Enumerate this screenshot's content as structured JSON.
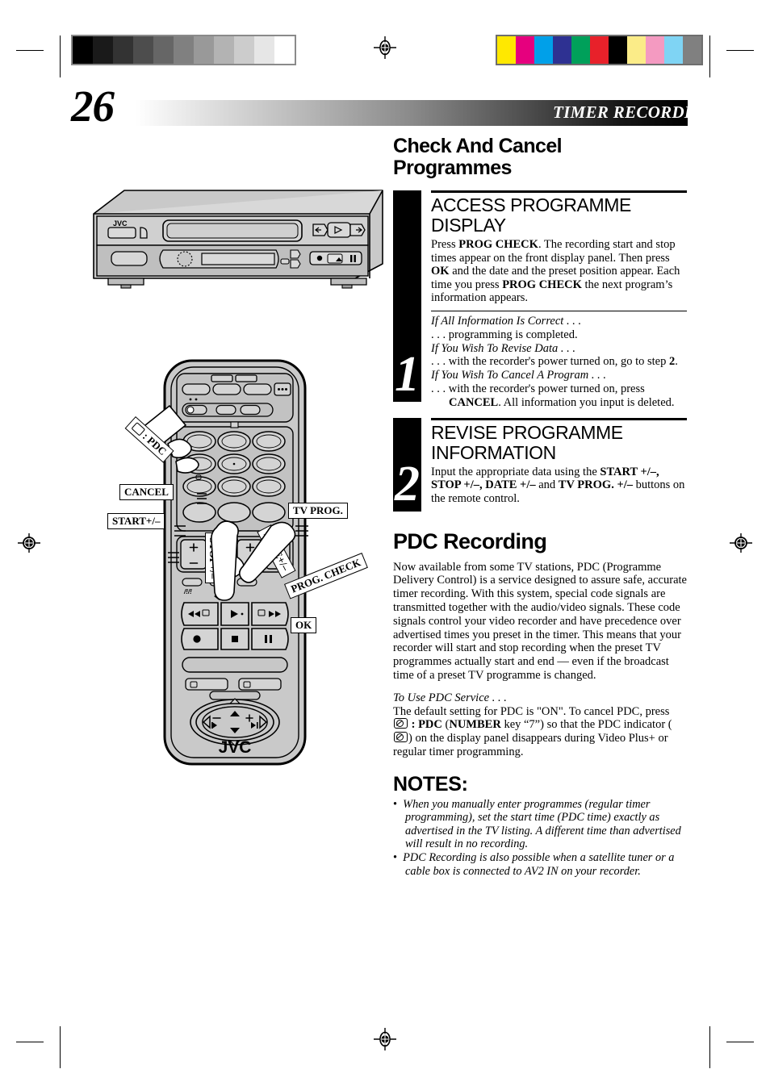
{
  "header": {
    "page_number": "26",
    "title": "TIMER RECORDING(cont.)"
  },
  "section": {
    "title_line1": "Check And Cancel",
    "title_line2": "Programmes"
  },
  "steps": [
    {
      "number": "1",
      "heading_line1": "ACCESS PROGRAMME",
      "heading_line2": "DISPLAY",
      "body_html": "Press <b>PROG CHECK</b>. The recording start and stop times appear on the front display panel. Then press <b>OK</b> and the date and the preset position appear. Each time you press <b>PROG CHECK</b> the next program&rsquo;s information appears.",
      "sub_lines": [
        {
          "style": "italic",
          "text": "If All Information Is Correct . . ."
        },
        {
          "style": "roman",
          "text": ". . . programming is completed."
        },
        {
          "style": "italic",
          "text": "If You Wish To Revise Data . . ."
        },
        {
          "style": "roman",
          "html": ". . . with the recorder's power turned on, go to step <b>2</b>."
        },
        {
          "style": "italic",
          "text": "If You Wish To Cancel A Program . . ."
        },
        {
          "style": "roman",
          "html": ". . . with the recorder's power turned on, press <b>CANCEL</b>. All information you input is deleted."
        }
      ]
    },
    {
      "number": "2",
      "heading_line1": "REVISE PROGRAMME",
      "heading_line2": "INFORMATION",
      "body_html": "Input the appropriate data using the <b>START +/&ndash;, STOP +/&ndash;, DATE +/&ndash;</b> and <b>TV PROG. +/&ndash;</b> buttons on the remote control.",
      "sub_lines": []
    }
  ],
  "pdc": {
    "title": "PDC Recording",
    "paragraph": "Now available from some TV stations, PDC (Programme Delivery Control) is a service designed to assure safe, accurate timer recording. With this system, special code signals are transmitted together with the audio/video signals. These code signals control your video recorder and have precedence over advertised times you preset in the timer. This means that your recorder will start and stop recording when the preset TV programmes actually start and end — even if the broadcast time of a preset TV programme is changed.",
    "service_heading": "To Use PDC Service . . .",
    "service_paragraph_html": "The default setting for PDC is \"ON\". To cancel PDC, press <span class=\"pdcicon\" data-name=\"pdc-symbol-icon\" data-interactable=\"false\"></span> <b>: PDC</b> (<b>NUMBER</b> key &ldquo;7&rdquo;) so that the PDC indicator (<span class=\"pdcicon\" data-name=\"pdc-symbol-icon\" data-interactable=\"false\"></span>) on the display panel disappears during Video Plus+ or regular timer programming."
  },
  "notes": {
    "title": "NOTES:",
    "items": [
      "When you manually enter programmes (regular timer programming), set the start time (PDC time) exactly as advertised in the TV listing. A different time than advertised will result in no recording.",
      "PDC Recording is also possible when a satellite tuner or a cable box is connected to AV2 IN on your recorder."
    ]
  },
  "illustrations": {
    "vcr": {
      "brand": "JVC"
    },
    "remote": {
      "brand": "JVC",
      "callouts": [
        {
          "label": ": PDC",
          "name": "callout-pdc"
        },
        {
          "label": "CANCEL",
          "name": "callout-cancel"
        },
        {
          "label": "START+/–",
          "name": "callout-start"
        },
        {
          "label": "TV PROG.",
          "name": "callout-tv-prog"
        },
        {
          "label": "STOP+/–",
          "name": "callout-stop"
        },
        {
          "label": "DATE+/–",
          "name": "callout-date"
        },
        {
          "label": "PROG. CHECK",
          "name": "callout-prog-check"
        },
        {
          "label": "OK",
          "name": "callout-ok"
        }
      ]
    }
  },
  "print_marks": {
    "grayscale_steps": [
      "#000000",
      "#1a1a1a",
      "#333333",
      "#4d4d4d",
      "#666666",
      "#808080",
      "#999999",
      "#b3b3b3",
      "#cccccc",
      "#e6e6e6",
      "#ffffff"
    ],
    "color_steps": [
      "#ffe800",
      "#e6007e",
      "#00a0e9",
      "#2e3192",
      "#00a05a",
      "#e8212a",
      "#000000",
      "#fbec88",
      "#f49ac1",
      "#7fd4f4",
      "#808080"
    ]
  }
}
